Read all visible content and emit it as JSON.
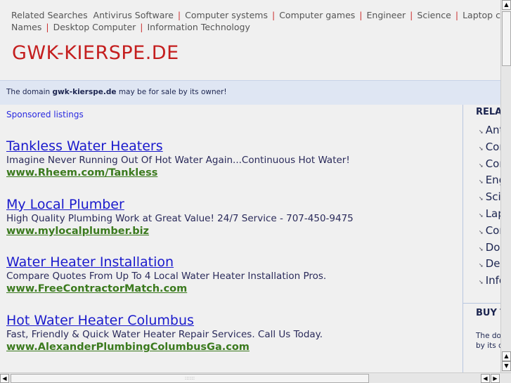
{
  "related_searches": {
    "label": "Related Searches",
    "items": [
      "Antivirus Software",
      "Computer systems",
      "Computer games",
      "Engineer",
      "Science",
      "Laptop computer"
    ],
    "items_line2": [
      "Names",
      "Desktop Computer",
      "Information Technology"
    ]
  },
  "site_title": "GWK-KIERSPE.DE",
  "banner": {
    "prefix": "The domain ",
    "domain": "gwk-kierspe.de",
    "suffix": " may be for sale by its owner!"
  },
  "sponsored_label": "Sponsored listings",
  "ads": [
    {
      "title": "Tankless Water Heaters",
      "desc": "Imagine Never Running Out Of Hot Water Again...Continuous Hot Water!",
      "url": "www.Rheem.com/Tankless"
    },
    {
      "title": "My Local Plumber",
      "desc": "High Quality Plumbing Work at Great Value! 24/7 Service - 707-450-9475",
      "url": "www.mylocalplumber.biz"
    },
    {
      "title": "Water Heater Installation",
      "desc": "Compare Quotes From Up To 4 Local Water Heater Installation Pros.",
      "url": "www.FreeContractorMatch.com"
    },
    {
      "title": "Hot Water Heater Columbus",
      "desc": "Fast, Friendly & Quick Water Heater Repair Services. Call Us Today.",
      "url": "www.AlexanderPlumbingColumbusGa.com"
    }
  ],
  "sidebar": {
    "heading": "RELA",
    "items": [
      "Ant",
      "Cor",
      "Cor",
      "Eng",
      "Scie",
      "Lap",
      "Cor",
      "Dor",
      "Des",
      "Info"
    ],
    "buy_heading": "BUY T",
    "buy_text_1": "The do",
    "buy_text_2": "by its c"
  }
}
